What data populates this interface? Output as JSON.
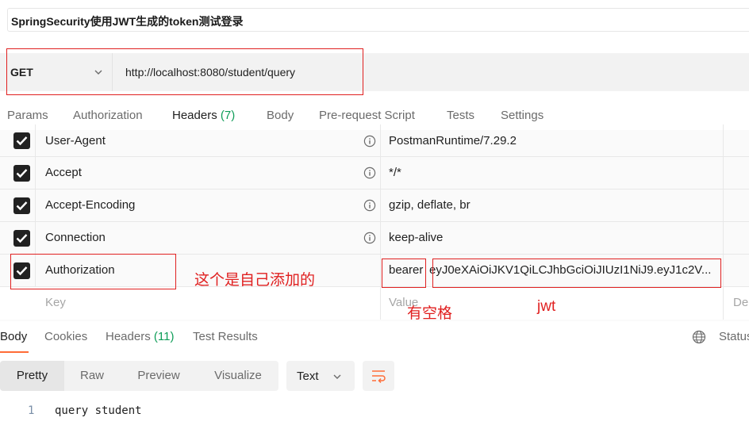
{
  "request": {
    "title": "SpringSecurity使用JWT生成的token测试登录",
    "method": "GET",
    "url": "http://localhost:8080/student/query"
  },
  "request_tabs": [
    {
      "label": "Params"
    },
    {
      "label": "Authorization"
    },
    {
      "label": "Headers",
      "count": "(7)"
    },
    {
      "label": "Body"
    },
    {
      "label": "Pre-request Script"
    },
    {
      "label": "Tests"
    },
    {
      "label": "Settings"
    }
  ],
  "headers": {
    "rows": [
      {
        "key": "User-Agent",
        "value": "PostmanRuntime/7.29.2",
        "checked": true
      },
      {
        "key": "Accept",
        "value": "*/*",
        "checked": true
      },
      {
        "key": "Accept-Encoding",
        "value": "gzip, deflate, br",
        "checked": true
      },
      {
        "key": "Connection",
        "value": "keep-alive",
        "checked": true
      },
      {
        "key": "Authorization",
        "value_prefix": "bearer",
        "value_token": "eyJ0eXAiOiJKV1QiLCJhbGciOiJIUzI1NiJ9.eyJ1c2V...",
        "checked": true
      }
    ],
    "new_row": {
      "key_placeholder": "Key",
      "value_placeholder": "Value",
      "description_placeholder": "De"
    }
  },
  "annotations": {
    "self_added": "这个是自己添加的",
    "has_space": "有空格",
    "jwt": "jwt"
  },
  "response": {
    "tabs": [
      {
        "label": "Body"
      },
      {
        "label": "Cookies"
      },
      {
        "label": "Headers",
        "count": "(11)"
      },
      {
        "label": "Test Results"
      }
    ],
    "status_label": "Status",
    "view_modes": [
      "Pretty",
      "Raw",
      "Preview",
      "Visualize"
    ],
    "format": "Text",
    "lines": [
      {
        "number": "1",
        "text": "query student"
      }
    ]
  },
  "colors": {
    "accent": "#ff6c37",
    "count_green": "#0f9d58",
    "annotation_red": "#e02020"
  }
}
